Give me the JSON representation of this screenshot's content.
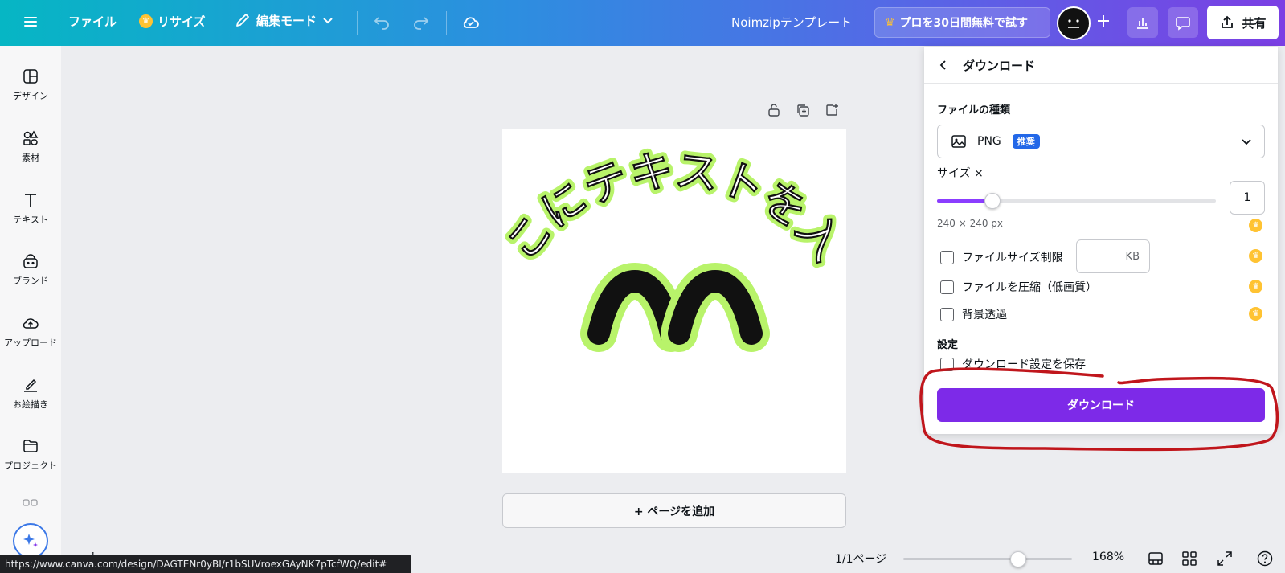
{
  "topbar": {
    "file_label": "ファイル",
    "resize_label": "リサイズ",
    "edit_mode_label": "編集モード",
    "doc_title": "Noimzipテンプレート",
    "promo_label": "プロを30日間無料で試す",
    "share_label": "共有"
  },
  "sidebar": {
    "items": [
      {
        "label": "デザイン"
      },
      {
        "label": "素材"
      },
      {
        "label": "テキスト"
      },
      {
        "label": "ブランド"
      },
      {
        "label": "アップロード"
      },
      {
        "label": "お絵描き"
      },
      {
        "label": "プロジェクト"
      }
    ]
  },
  "canvas": {
    "arc_text": "ここにテキストを入力",
    "add_page_label": "+ ページを追加"
  },
  "download_panel": {
    "title": "ダウンロード",
    "file_type_label": "ファイルの種類",
    "file_type_value": "PNG",
    "recommended_badge": "推奨",
    "size_label": "サイズ ×",
    "size_value": "1",
    "size_slider_fraction": 0.2,
    "dimensions": "240 × 240 px",
    "file_size_limit_label": "ファイルサイズ制限",
    "kb_unit": "KB",
    "compress_label": "ファイルを圧縮（低画質）",
    "transparent_bg_label": "背景透過",
    "settings_label": "設定",
    "save_settings_label": "ダウンロード設定を保存",
    "download_button": "ダウンロード"
  },
  "bottom": {
    "page_indicator": "1/1ページ",
    "zoom": "168%",
    "zoom_slider_fraction": 0.68,
    "url_tooltip": "https://www.canva.com/design/DAGTENr0yBI/r1bSUVroexGAyNK7pTcfWQ/edit#"
  },
  "colors": {
    "accent_purple": "#7d2ae8",
    "badge_blue": "#2368e8",
    "annotation_red": "#c0161c",
    "text_glow": "#b8f36a"
  }
}
